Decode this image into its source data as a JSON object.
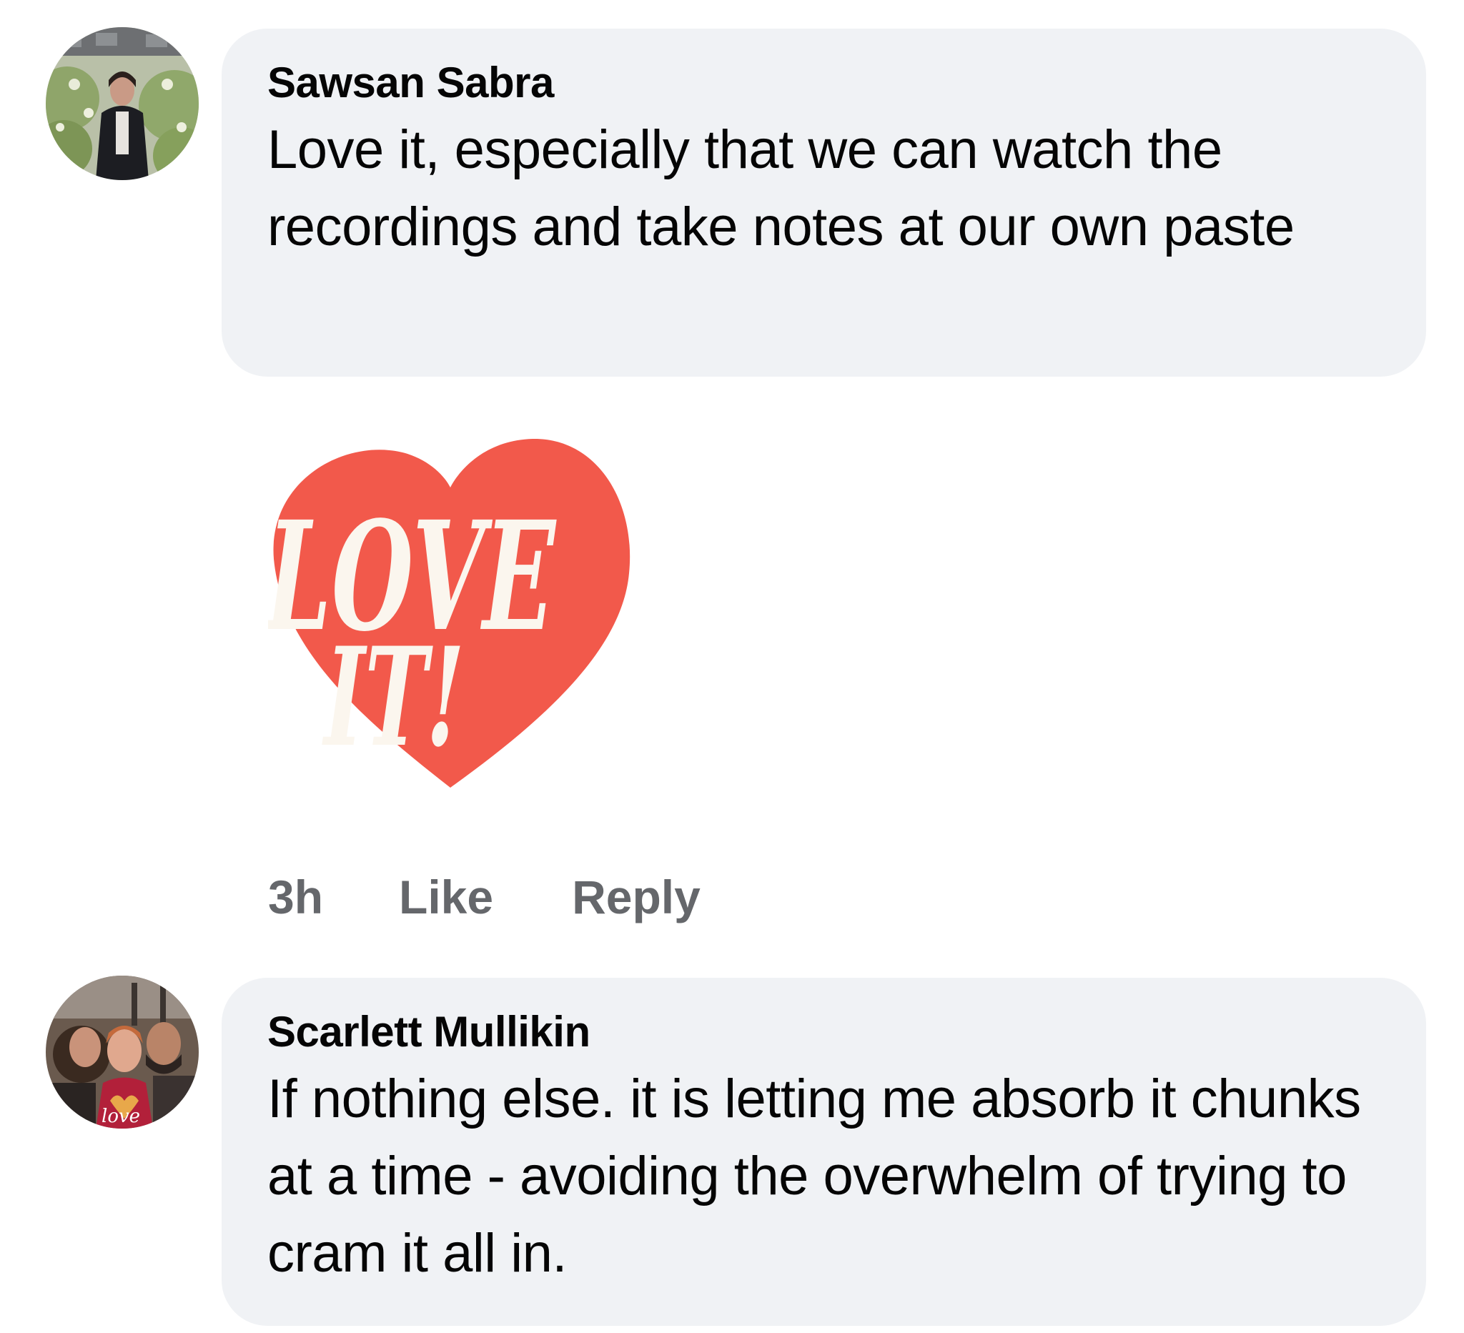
{
  "comments": [
    {
      "author": "Sawsan Sabra",
      "text": "Love it, especially that we can watch the recordings and take notes at our own paste",
      "sticker_text": [
        "LOVE",
        "IT!"
      ],
      "time": "3h",
      "like_label": "Like",
      "reply_label": "Reply"
    },
    {
      "author": "Scarlett Mullikin",
      "text": "If nothing else. it is letting me absorb it chunks at a time - avoiding the overwhelm of trying to cram it all in.",
      "avatar_overlay_text": "love"
    }
  ],
  "colors": {
    "bubble_bg": "#f0f2f5",
    "text": "#050505",
    "meta": "#65676b",
    "sticker_heart": "#f2594b",
    "sticker_letters": "#fbf6ee"
  }
}
